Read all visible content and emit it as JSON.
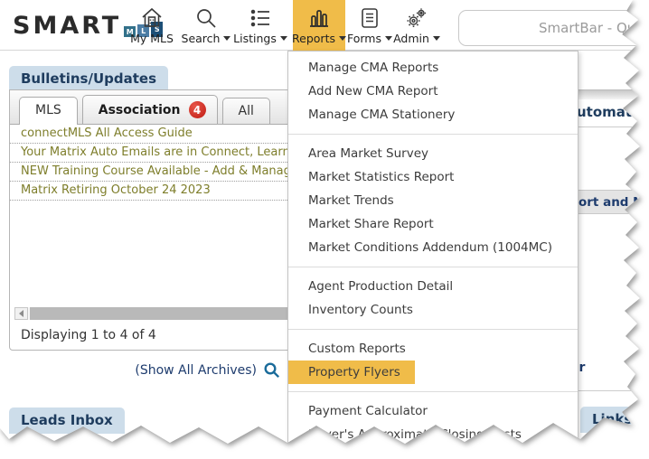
{
  "brand": {
    "word": "SMART",
    "blocks": [
      "M",
      "L",
      "S"
    ]
  },
  "nav": {
    "items": [
      {
        "label": "My MLS"
      },
      {
        "label": "Search"
      },
      {
        "label": "Listings"
      },
      {
        "label": "Reports"
      },
      {
        "label": "Forms"
      },
      {
        "label": "Admin"
      }
    ],
    "smartbar_placeholder": "SmartBar - Quickly find listin"
  },
  "reports_menu": {
    "groups": [
      {
        "items": [
          {
            "label": "Manage CMA Reports"
          },
          {
            "label": "Add New CMA Report"
          },
          {
            "label": "Manage CMA Stationery"
          }
        ]
      },
      {
        "items": [
          {
            "label": "Area Market Survey"
          },
          {
            "label": "Market Statistics Report"
          },
          {
            "label": "Market Trends"
          },
          {
            "label": "Market Share Report"
          },
          {
            "label": "Market Conditions Addendum (1004MC)"
          }
        ]
      },
      {
        "items": [
          {
            "label": "Agent Production Detail"
          },
          {
            "label": "Inventory Counts"
          }
        ]
      },
      {
        "items": [
          {
            "label": "Custom Reports"
          },
          {
            "label": "Property Flyers",
            "highlighted": true
          }
        ]
      },
      {
        "items": [
          {
            "label": "Payment Calculator"
          },
          {
            "label": "Buyer's Approximate Closing Costs"
          }
        ]
      }
    ]
  },
  "bulletins": {
    "title": "Bulletins/Updates",
    "tabs": [
      {
        "label": "MLS"
      },
      {
        "label": "Association",
        "badge": "4"
      },
      {
        "label": "All"
      }
    ],
    "items": [
      "connectMLS All Access Guide",
      "Your Matrix Auto Emails are in Connect, Learn How to",
      "NEW Training Course Available - Add & Manage Listing",
      "Matrix Retiring October 24 2023"
    ],
    "status": "Displaying 1 to 4 of 4",
    "archives_link": "(Show All Archives)"
  },
  "leads": {
    "title": "Leads Inbox"
  },
  "right_fragments": {
    "top_partial": "utomatic",
    "middle_partial": "ort and Nort",
    "small_partial": "er",
    "links_title": "Links"
  },
  "colors": {
    "accent_highlight": "#f0bc49",
    "badge_red": "#bf1a12",
    "section_header_bg": "#cdddea",
    "navy_text": "#1e3c5e",
    "bulletin_olive": "#7e7e2b",
    "search_icon_blue": "#1a6b9a"
  }
}
